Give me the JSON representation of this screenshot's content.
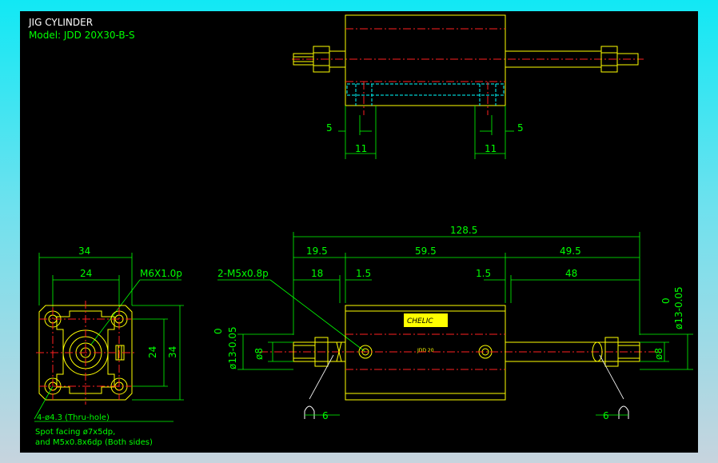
{
  "title": {
    "line1": "JIG CYLINDER",
    "line2": "Model:  JDD 20X30-B-S"
  },
  "colors": {
    "outline": "#ffff00",
    "centerline": "#ff2020",
    "dimension": "#00ff00",
    "hidden": "#00ffff",
    "title": "#ffffff"
  },
  "top_view": {
    "dim_left_small": "5",
    "dim_right_small": "5",
    "dim_left_width": "11",
    "dim_right_width": "11"
  },
  "side_view": {
    "dim_overall": "128.5",
    "dim_left_rod": "19.5",
    "dim_body": "59.5",
    "dim_right_rod": "49.5",
    "dim_left_thread": "18",
    "dim_left_gap": "1.5",
    "dim_right_gap": "1.5",
    "dim_right_thread": "48",
    "port_label": "2-M5x0.8p",
    "dia_left_tol_upper": "0",
    "dia_left": "ø13-0.05",
    "dia_left_small": "ø8",
    "dia_right_tol_upper": "0",
    "dia_right": "ø13-0.05",
    "dia_right_small": "ø8",
    "fitting_dim_left": "6",
    "fitting_dim_right": "6",
    "label_brand": "CHELIC",
    "label_model": "JDD 20"
  },
  "end_view": {
    "dim_outer_width": "34",
    "dim_inner_width": "24",
    "thread_label": "M6X1.0p",
    "dim_inner_height": "24",
    "dim_outer_height": "34",
    "hole_note": "4-ø4.3 (Thru-hole)",
    "spot_note_line1": "Spot facing  ø7x5dp,",
    "spot_note_line2": "and M5x0.8x6dp (Both sides)"
  }
}
